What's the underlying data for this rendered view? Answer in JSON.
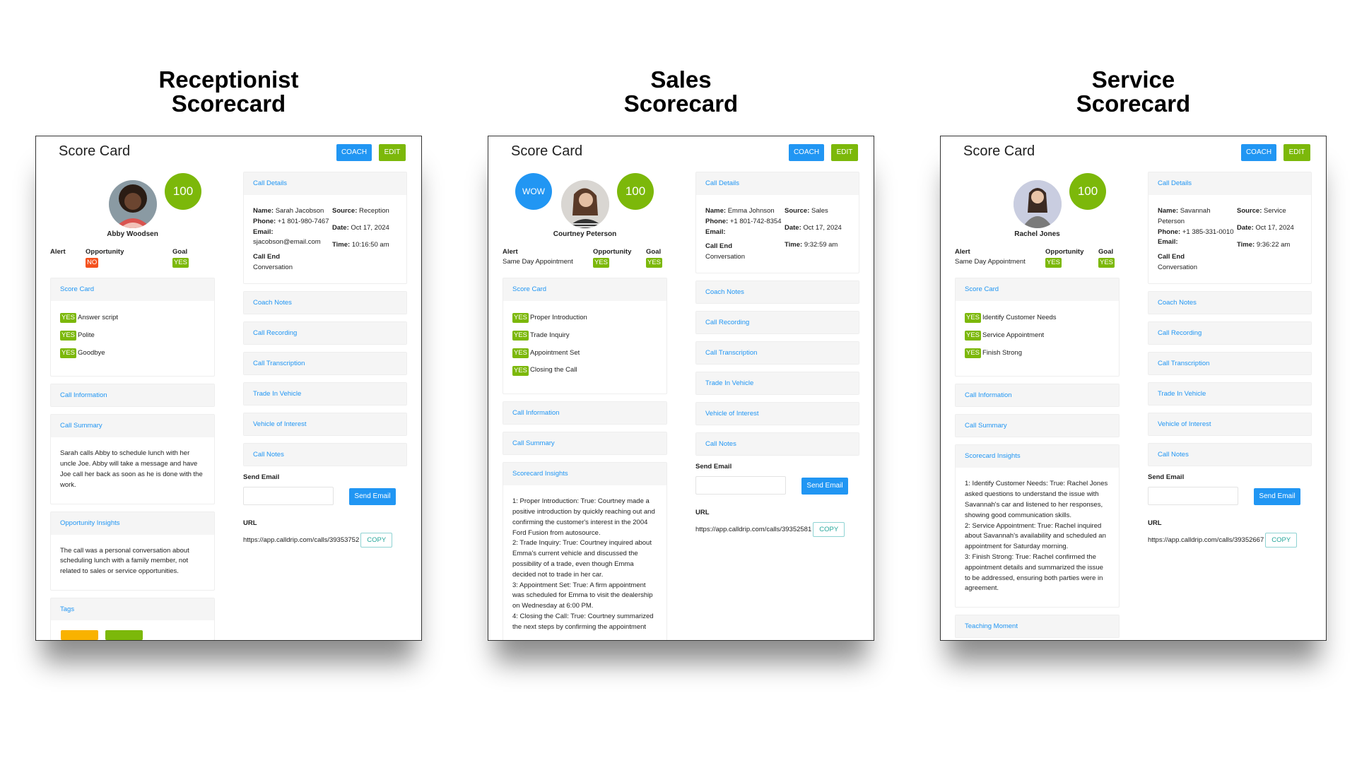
{
  "colors": {
    "accent_blue": "#2196f3",
    "yes_green": "#7cb80a",
    "no_red": "#f4511e",
    "copy_teal": "#26a69a",
    "tag_orange": "#f9b200",
    "tag_green": "#7cb80a"
  },
  "cards": [
    {
      "heading_line1": "Receptionist",
      "heading_line2": "Scorecard",
      "title": "Score Card",
      "coach_label": "COACH",
      "edit_label": "EDIT",
      "agent_name": "Abby Woodsen",
      "score": "100",
      "wow": null,
      "alert_label": "Alert",
      "alert_value": "",
      "opportunity_label": "Opportunity",
      "opportunity_value": "NO",
      "goal_label": "Goal",
      "goal_value": "YES",
      "scorecard_title": "Score Card",
      "scorecard_items": [
        {
          "status": "YES",
          "label": "Answer script"
        },
        {
          "status": "YES",
          "label": "Polite"
        },
        {
          "status": "YES",
          "label": "Goodbye"
        }
      ],
      "left_panels": [
        {
          "title": "Call Information",
          "body": null
        },
        {
          "title": "Call Summary",
          "body": "Sarah calls Abby to schedule lunch with her uncle Joe. Abby will take a message and have Joe call her back as soon as he is done with the work."
        },
        {
          "title": "Opportunity Insights",
          "body": "The call was a personal conversation about scheduling lunch with a family member, not related to sales or service opportunities."
        },
        {
          "title": "Tags",
          "body": null
        }
      ],
      "call_details": {
        "title": "Call Details",
        "name_label": "Name:",
        "name": "Sarah Jacobson",
        "phone_label": "Phone:",
        "phone": "+1 801-980-7467",
        "email_label": "Email:",
        "email": "sjacobson@email.com",
        "call_end_label": "Call End",
        "call_end": "Conversation",
        "source_label": "Source:",
        "source": "Reception",
        "date_label": "Date:",
        "date": "Oct 17, 2024",
        "time_label": "Time:",
        "time": "10:16:50 am"
      },
      "right_panels": [
        "Coach Notes",
        "Call Recording",
        "Call Transcription",
        "Trade In Vehicle",
        "Vehicle of Interest",
        "Call Notes"
      ],
      "send_email_label": "Send Email",
      "send_email_button": "Send Email",
      "email_value": "",
      "url_label": "URL",
      "url": "https://app.calldrip.com/calls/39353752",
      "copy_label": "COPY"
    },
    {
      "heading_line1": "Sales",
      "heading_line2": "Scorecard",
      "title": "Score Card",
      "coach_label": "COACH",
      "edit_label": "EDIT",
      "agent_name": "Courtney Peterson",
      "score": "100",
      "wow": "WOW",
      "alert_label": "Alert",
      "alert_value": "Same Day Appointment",
      "opportunity_label": "Opportunity",
      "opportunity_value": "YES",
      "goal_label": "Goal",
      "goal_value": "YES",
      "scorecard_title": "Score Card",
      "scorecard_items": [
        {
          "status": "YES",
          "label": "Proper Introduction"
        },
        {
          "status": "YES",
          "label": "Trade Inquiry"
        },
        {
          "status": "YES",
          "label": "Appointment Set"
        },
        {
          "status": "YES",
          "label": "Closing the Call"
        }
      ],
      "left_panels": [
        {
          "title": "Call Information",
          "body": null
        },
        {
          "title": "Call Summary",
          "body": null
        },
        {
          "title": "Scorecard Insights",
          "body": "1: Proper Introduction: True: Courtney made a positive introduction by quickly reaching out and confirming the customer's interest in the 2004 Ford Fusion from autosource.\n2: Trade Inquiry: True: Courtney inquired about Emma's current vehicle and discussed the possibility of a trade, even though Emma decided not to trade in her car.\n3: Appointment Set: True: A firm appointment was scheduled for Emma to visit the dealership on Wednesday at 6:00 PM.\n4: Closing the Call: True: Courtney summarized the next steps by confirming the appointment"
        }
      ],
      "call_details": {
        "title": "Call Details",
        "name_label": "Name:",
        "name": "Emma Johnson",
        "phone_label": "Phone:",
        "phone": "+1 801-742-8354",
        "email_label": "Email:",
        "email": "",
        "call_end_label": "Call End",
        "call_end": "Conversation",
        "source_label": "Source:",
        "source": "Sales",
        "date_label": "Date:",
        "date": "Oct 17, 2024",
        "time_label": "Time:",
        "time": "9:32:59 am"
      },
      "right_panels": [
        "Coach Notes",
        "Call Recording",
        "Call Transcription",
        "Trade In Vehicle",
        "Vehicle of Interest",
        "Call Notes"
      ],
      "send_email_label": "Send Email",
      "send_email_button": "Send Email",
      "email_value": "",
      "url_label": "URL",
      "url": "https://app.calldrip.com/calls/39352581",
      "copy_label": "COPY"
    },
    {
      "heading_line1": "Service",
      "heading_line2": "Scorecard",
      "title": "Score Card",
      "coach_label": "COACH",
      "edit_label": "EDIT",
      "agent_name": "Rachel Jones",
      "score": "100",
      "wow": null,
      "alert_label": "Alert",
      "alert_value": "Same Day Appointment",
      "opportunity_label": "Opportunity",
      "opportunity_value": "YES",
      "goal_label": "Goal",
      "goal_value": "YES",
      "scorecard_title": "Score Card",
      "scorecard_items": [
        {
          "status": "YES",
          "label": "Identify Customer Needs"
        },
        {
          "status": "YES",
          "label": "Service Appointment"
        },
        {
          "status": "YES",
          "label": "Finish Strong"
        }
      ],
      "left_panels": [
        {
          "title": "Call Information",
          "body": null
        },
        {
          "title": "Call Summary",
          "body": null
        },
        {
          "title": "Scorecard Insights",
          "body": "1: Identify Customer Needs: True: Rachel Jones asked questions to understand the issue with Savannah's car and listened to her responses, showing good communication skills.\n2: Service Appointment: True: Rachel inquired about Savannah's availability and scheduled an appointment for Saturday morning.\n3: Finish Strong: True: Rachel confirmed the appointment details and summarized the issue to be addressed, ensuring both parties were in agreement."
        },
        {
          "title": "Teaching Moment",
          "body": null
        }
      ],
      "call_details": {
        "title": "Call Details",
        "name_label": "Name:",
        "name": "Savannah Peterson",
        "phone_label": "Phone:",
        "phone": "+1 385-331-0010",
        "email_label": "Email:",
        "email": "",
        "call_end_label": "Call End",
        "call_end": "Conversation",
        "source_label": "Source:",
        "source": "Service",
        "date_label": "Date:",
        "date": "Oct 17, 2024",
        "time_label": "Time:",
        "time": "9:36:22 am"
      },
      "right_panels": [
        "Coach Notes",
        "Call Recording",
        "Call Transcription",
        "Trade In Vehicle",
        "Vehicle of Interest",
        "Call Notes"
      ],
      "send_email_label": "Send Email",
      "send_email_button": "Send Email",
      "email_value": "",
      "url_label": "URL",
      "url": "https://app.calldrip.com/calls/39352667",
      "copy_label": "COPY"
    }
  ]
}
